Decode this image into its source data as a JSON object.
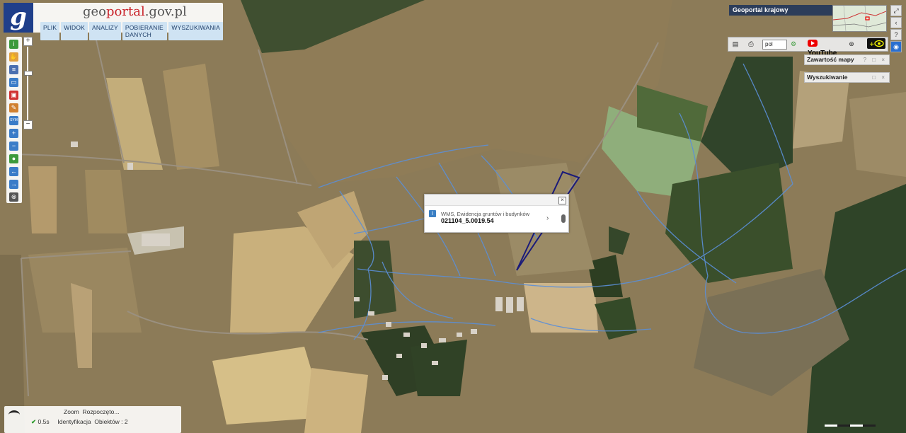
{
  "header": {
    "logo_letter": "g",
    "title_part1": "geo",
    "title_part2": "portal",
    "title_part3": ".gov.pl",
    "menu": [
      "PLIK",
      "WIDOK",
      "ANALIZY",
      "POBIERANIE DANYCH",
      "WYSZUKIWANIA"
    ]
  },
  "toolbar": {
    "tools": [
      {
        "icon": "info-icon",
        "glyph": "i",
        "color": "#3c9a3c"
      },
      {
        "icon": "pan-icon",
        "glyph": "✋",
        "color": "#e0a040"
      },
      {
        "icon": "layers-list-icon",
        "glyph": "≡",
        "color": "#4a6fb0"
      },
      {
        "icon": "select-icon",
        "glyph": "▭",
        "color": "#3a7cc8"
      },
      {
        "icon": "print-area-icon",
        "glyph": "▣",
        "color": "#d03030"
      },
      {
        "icon": "measure-icon",
        "glyph": "✎",
        "color": "#d08030"
      },
      {
        "icon": "sym-icon",
        "glyph": "SYM",
        "color": "#3a7cc8"
      },
      {
        "icon": "zoom-in-icon",
        "glyph": "+",
        "color": "#3a7cc8"
      },
      {
        "icon": "zoom-out-icon",
        "glyph": "−",
        "color": "#3a7cc8"
      },
      {
        "icon": "globe-icon",
        "glyph": "●",
        "color": "#3c9a3c"
      },
      {
        "icon": "back-arrow-icon",
        "glyph": "←",
        "color": "#3a7cc8"
      },
      {
        "icon": "forward-arrow-icon",
        "glyph": "→",
        "color": "#3a7cc8"
      },
      {
        "icon": "full-extent-icon",
        "glyph": "⊗",
        "color": "#555555"
      }
    ],
    "zoom_in": "+",
    "zoom_out": "−"
  },
  "right_panel": {
    "geoportal_krajowy": "Geoportal krajowy",
    "language": "pol",
    "youtube_label": "YouTube",
    "panels": [
      {
        "title": "Zawartość mapy",
        "controls": "? □ ×"
      },
      {
        "title": "Wyszukiwanie",
        "controls": "□ ×"
      }
    ]
  },
  "popup": {
    "layer": "WMS, Ewidencja gruntów i budynków",
    "parcel_id": "021104_5.0019.54",
    "close": "×",
    "next": "›"
  },
  "status": {
    "row1_label": "Zoom",
    "row1_value": "Rozpoczęto...",
    "row2_time": "0.5s",
    "row2_label": "Identyfikacja",
    "row2_value": "Obiektów : 2"
  },
  "colors": {
    "brand_blue": "#1f3f8a",
    "parcel_outline": "#1a1a7a",
    "parcel_lines": "#5b8fd8",
    "accent_red": "#c9232a"
  }
}
